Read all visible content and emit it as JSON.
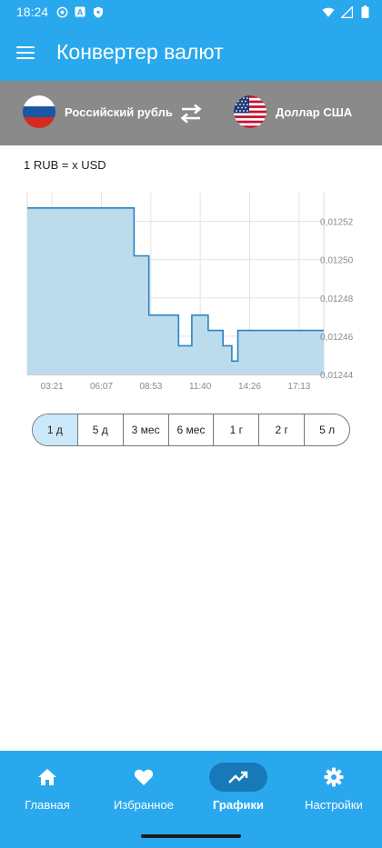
{
  "status_bar": {
    "time": "18:24",
    "icons": [
      "settings-notification-icon",
      "a-box-icon",
      "shield-icon"
    ],
    "right_icons": [
      "wifi-icon",
      "signal-icon",
      "battery-icon"
    ]
  },
  "toolbar": {
    "title": "Конвертер валют",
    "menu_icon": "menu-icon"
  },
  "currency": {
    "from_label": "Российский рубль",
    "to_label": "Доллар США",
    "swap_icon": "swap-arrows-icon"
  },
  "rate_caption": "1 RUB = x USD",
  "chart_data": {
    "type": "area",
    "x_ticks": [
      "03:21",
      "06:07",
      "08:53",
      "11:40",
      "14:26",
      "17:13"
    ],
    "y_ticks": [
      "0,01252",
      "0,01250",
      "0,01248",
      "0,01246",
      "0,01244"
    ],
    "ylim": [
      0.01244,
      0.012535
    ],
    "xlim": [
      0,
      100
    ],
    "grid": true,
    "steps": [
      [
        0,
        0.012527
      ],
      [
        36,
        0.012527
      ],
      [
        36,
        0.012502
      ],
      [
        41,
        0.012502
      ],
      [
        41,
        0.012471
      ],
      [
        51,
        0.012471
      ],
      [
        51,
        0.012455
      ],
      [
        55.5,
        0.012455
      ],
      [
        55.5,
        0.012471
      ],
      [
        61,
        0.012471
      ],
      [
        61,
        0.012463
      ],
      [
        66,
        0.012463
      ],
      [
        66,
        0.012455
      ],
      [
        69,
        0.012455
      ],
      [
        69,
        0.012447
      ],
      [
        71,
        0.012447
      ],
      [
        71,
        0.012463
      ],
      [
        100,
        0.012463
      ]
    ],
    "line_color": "#2a83c4",
    "fill_color": "#bcdcec"
  },
  "periods": {
    "items": [
      "1 д",
      "5 д",
      "3 мес",
      "6 мес",
      "1 г",
      "2 г",
      "5 л"
    ],
    "active": 0
  },
  "bottom_nav": {
    "items": [
      {
        "label": "Главная",
        "icon": "home-icon"
      },
      {
        "label": "Избранное",
        "icon": "heart-icon"
      },
      {
        "label": "Графики",
        "icon": "trending-up-icon"
      },
      {
        "label": "Настройки",
        "icon": "gear-icon"
      }
    ],
    "active": 2
  }
}
